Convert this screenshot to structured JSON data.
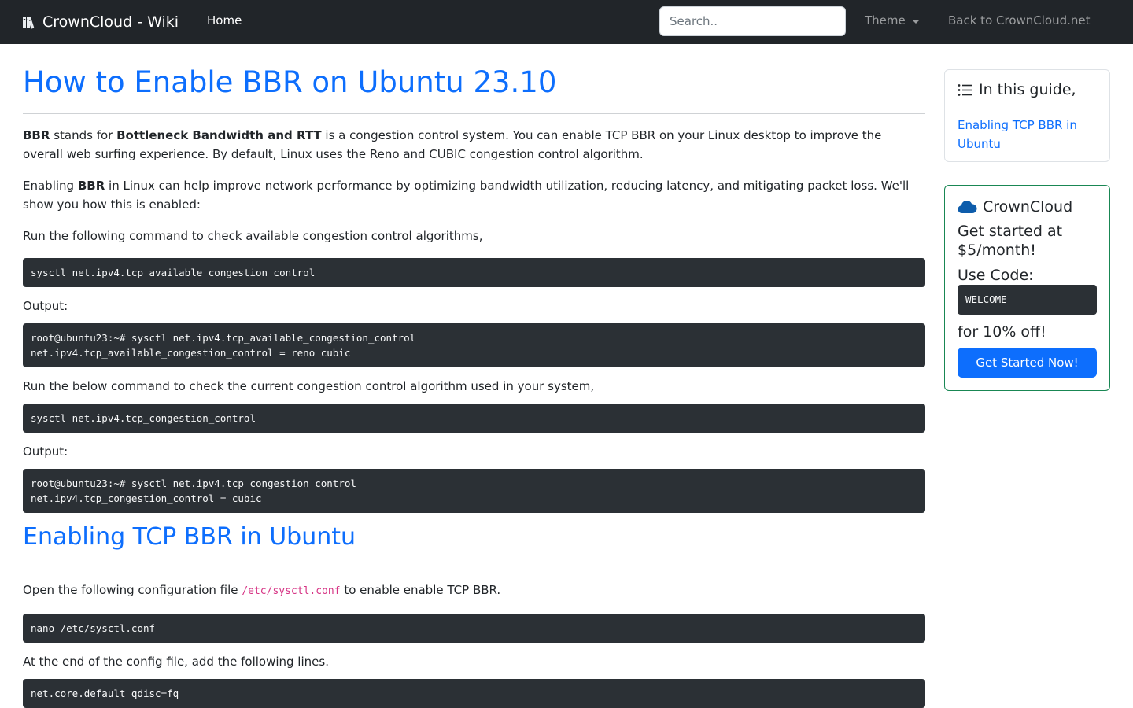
{
  "navbar": {
    "brand": "CrownCloud - Wiki",
    "home": "Home",
    "search_placeholder": "Search..",
    "theme": "Theme",
    "back_link": "Back to CrownCloud.net"
  },
  "article": {
    "title": "How to Enable BBR on Ubuntu 23.10",
    "intro": {
      "bbr": "BBR",
      "stands_for": " stands for ",
      "expansion": "Bottleneck Bandwidth and RTT",
      "rest": " is a congestion control system. You can enable TCP BBR on your Linux desktop to improve the overall web surfing experience. By default, Linux uses the Reno and CUBIC congestion control algorithm."
    },
    "enabling": {
      "lead": "Enabling ",
      "bbr": "BBR",
      "rest": " in Linux can help improve network performance by optimizing bandwidth utilization, reducing latency, and mitigating packet loss. We'll show you how this is enabled:"
    },
    "step_available": "Run the following command to check available congestion control algorithms,",
    "cmd_available": "sysctl net.ipv4.tcp_available_congestion_control",
    "output_label_1": "Output:",
    "out_available": "root@ubuntu23:~# sysctl net.ipv4.tcp_available_congestion_control\nnet.ipv4.tcp_available_congestion_control = reno cubic",
    "step_current": "Run the below command to check the current congestion control algorithm used in your system,",
    "cmd_current": "sysctl net.ipv4.tcp_congestion_control",
    "output_label_2": "Output:",
    "out_current": "root@ubuntu23:~# sysctl net.ipv4.tcp_congestion_control\nnet.ipv4.tcp_congestion_control = cubic",
    "section_title": "Enabling TCP BBR in Ubuntu",
    "open_config": {
      "lead": "Open the following configuration file ",
      "file": "/etc/sysctl.conf",
      "rest": " to enable enable TCP BBR."
    },
    "cmd_nano": "nano /etc/sysctl.conf",
    "end_config": "At the end of the config file, add the following lines.",
    "cfg_lines": "net.core.default_qdisc=fq"
  },
  "sidebar": {
    "guide_title": "In this guide,",
    "guide_link": "Enabling TCP BBR in Ubuntu",
    "promo_title": "CrownCloud",
    "promo_price": "Get started at $5/month!",
    "promo_use_code": "Use Code:",
    "promo_code": "WELCOME",
    "promo_discount": "for 10% off!",
    "promo_button": "Get Started Now!"
  },
  "colors": {
    "navbar_bg": "#212529",
    "link_blue": "#0d6efd",
    "code_bg": "#2b3035",
    "promo_border": "#198754",
    "cloud_icon": "#0d5cab",
    "inline_code": "#d63384"
  },
  "icons": {
    "brand": "books-icon",
    "guide": "list-icon",
    "promo": "cloud-icon"
  }
}
